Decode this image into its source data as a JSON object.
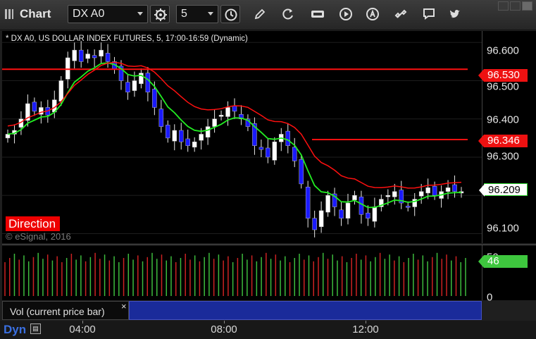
{
  "toolbar": {
    "title": "Chart",
    "symbol_value": "DX A0",
    "interval_value": "5",
    "icons": [
      "settings-gear-icon",
      "clock-icon",
      "pencil-draw-icon",
      "refresh-icon",
      "get-icon",
      "play-icon",
      "alert-icon",
      "link-icon",
      "comment-icon",
      "twitter-icon"
    ]
  },
  "chart": {
    "description": "* DX A0, US DOLLAR INDEX FUTURES, 5, 17:00-16:59 (Dynamic)",
    "direction_label": "Direction",
    "copyright": "© eSignal, 2016"
  },
  "price_axis": {
    "labels": [
      "96.600",
      "96.500",
      "96.400",
      "96.300",
      "96.100"
    ],
    "flags": {
      "upper_red": "96.530",
      "lower_red": "96.346",
      "last_price": "96.209"
    }
  },
  "volume": {
    "tab_label": "Vol (current price bar)",
    "close": "×",
    "axis_labels": [
      "50",
      "0"
    ],
    "flag": "46"
  },
  "time_axis": {
    "dyn_label": "Dyn",
    "labels": [
      "04:00",
      "08:00",
      "12:00"
    ]
  },
  "colors": {
    "up_candle": "#ffffff",
    "down_candle": "#1a1aff",
    "red_line": "#ff1010",
    "green_line": "#22ee22",
    "vol_up": "#3dbb3d",
    "vol_down": "#cc2222"
  },
  "chart_data": {
    "type": "candlestick",
    "price_range": [
      96.075,
      96.63
    ],
    "levels": [
      {
        "name": "upper",
        "value": 96.53
      },
      {
        "name": "lower",
        "value": 96.346
      }
    ],
    "close_series": [
      96.36,
      96.37,
      96.4,
      96.44,
      96.42,
      96.43,
      96.41,
      96.45,
      96.5,
      96.56,
      96.58,
      96.55,
      96.57,
      96.56,
      96.58,
      96.55,
      96.53,
      96.5,
      96.47,
      96.5,
      96.52,
      96.47,
      96.43,
      96.38,
      96.35,
      96.37,
      96.34,
      96.33,
      96.34,
      96.36,
      96.38,
      96.4,
      96.41,
      96.43,
      96.42,
      96.4,
      96.38,
      96.33,
      96.32,
      96.3,
      96.34,
      96.36,
      96.33,
      96.29,
      96.23,
      96.14,
      96.11,
      96.16,
      96.2,
      96.17,
      96.14,
      96.18,
      96.2,
      96.15,
      96.14,
      96.17,
      96.19,
      96.2,
      96.21,
      96.18,
      96.17,
      96.19,
      96.21,
      96.22,
      96.2,
      96.21,
      96.22,
      96.21,
      96.21
    ],
    "volume_bars": 98
  }
}
